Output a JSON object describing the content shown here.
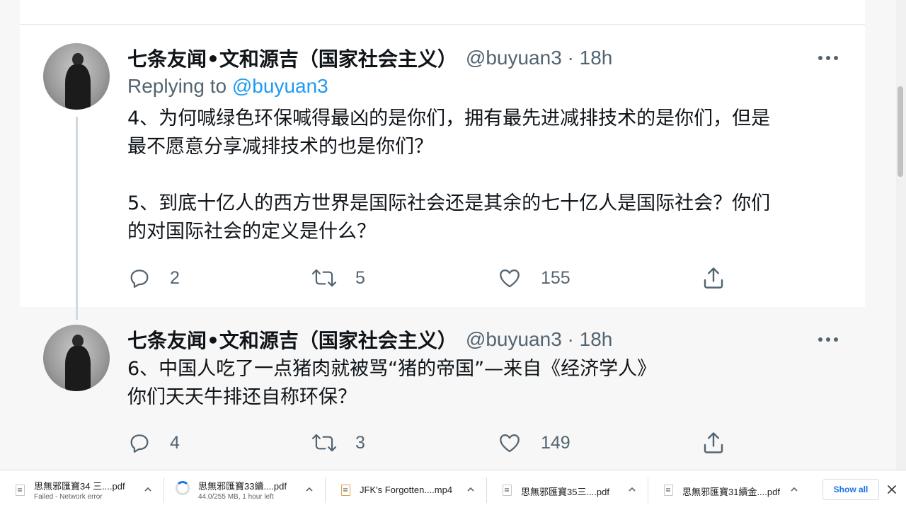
{
  "tweets": [
    {
      "display_name": "七条友闻•文和源吉（国家社会主义）",
      "handle_time": "@buyuan3 · 18h",
      "replying_prefix": "Replying to ",
      "replying_mention": "@buyuan3",
      "text": "4、为何喊绿色环保喊得最凶的是你们，拥有最先进减排技术的是你们，但是\n最不愿意分享减排技术的也是你们？\n\n5、到底十亿人的西方世界是国际社会还是其余的七十亿人是国际社会？你们\n的对国际社会的定义是什么？",
      "replies": "2",
      "retweets": "5",
      "likes": "155"
    },
    {
      "display_name": "七条友闻•文和源吉（国家社会主义）",
      "handle_time": "@buyuan3 · 18h",
      "text": "6、中国人吃了一点猪肉就被骂“猪的帝国”—来自《经济学人》\n你们天天牛排还自称环保？",
      "replies": "4",
      "retweets": "3",
      "likes": "149"
    }
  ],
  "downloads": [
    {
      "name": "思無邪匯寶34 三....pdf",
      "status": "Failed - Network error",
      "icon": "pdf-file-icon"
    },
    {
      "name": "思無邪匯寶33續....pdf",
      "status": "44.0/255 MB, 1 hour left",
      "icon": "download-progress-icon"
    },
    {
      "name": "JFK's Forgotten....mp4",
      "status": "",
      "icon": "video-file-icon"
    },
    {
      "name": "思無邪匯寶35三....pdf",
      "status": "",
      "icon": "pdf-file-icon"
    },
    {
      "name": "思無邪匯寶31續金....pdf",
      "status": "",
      "icon": "pdf-file-icon"
    }
  ],
  "download_bar": {
    "show_all": "Show all"
  },
  "colors": {
    "text": "#0f1419",
    "secondary": "#536471",
    "accent": "#1d9bf0",
    "highlight_bg": "#f7f7f7",
    "link_blue": "#1a73e8"
  }
}
